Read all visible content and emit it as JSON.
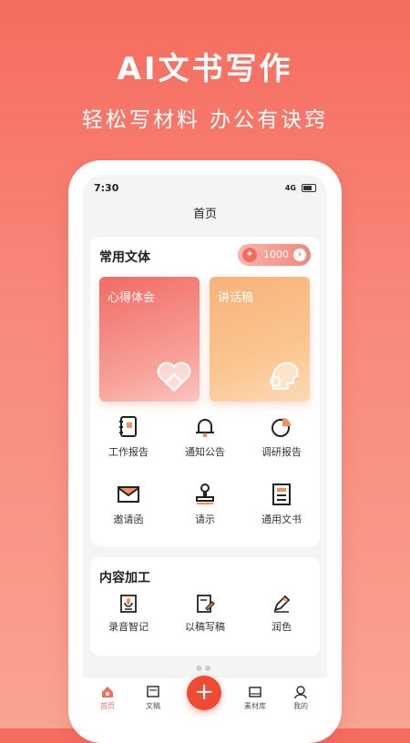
{
  "promo": {
    "title": "AI文书写作",
    "subtitle": "轻松写材料  办公有诀窍"
  },
  "status": {
    "time": "7:30",
    "signal": "4G"
  },
  "page": {
    "title": "首页"
  },
  "common": {
    "title": "常用文体",
    "points": "1000",
    "features": [
      {
        "label": "心得体会"
      },
      {
        "label": "讲话稿"
      }
    ],
    "items": [
      {
        "label": "工作报告",
        "icon": "notebook-icon"
      },
      {
        "label": "通知公告",
        "icon": "bell-icon"
      },
      {
        "label": "调研报告",
        "icon": "pie-chart-icon"
      },
      {
        "label": "邀请函",
        "icon": "envelope-icon"
      },
      {
        "label": "请示",
        "icon": "stamp-icon"
      },
      {
        "label": "通用文书",
        "icon": "document-icon"
      }
    ]
  },
  "processing": {
    "title": "内容加工",
    "items": [
      {
        "label": "录音智记",
        "icon": "voice-note-icon"
      },
      {
        "label": "以稿写稿",
        "icon": "edit-doc-icon"
      },
      {
        "label": "润色",
        "icon": "pen-icon"
      }
    ]
  },
  "tabs": [
    {
      "label": "首页",
      "icon": "home-icon",
      "active": true
    },
    {
      "label": "文稿",
      "icon": "manuscript-icon"
    },
    {
      "label": "",
      "icon": "plus-icon"
    },
    {
      "label": "素材库",
      "icon": "library-icon"
    },
    {
      "label": "我的",
      "icon": "profile-icon"
    }
  ],
  "colors": {
    "accent": "#f26d61",
    "fab": "#f04a32",
    "background": "#f56c5f"
  }
}
